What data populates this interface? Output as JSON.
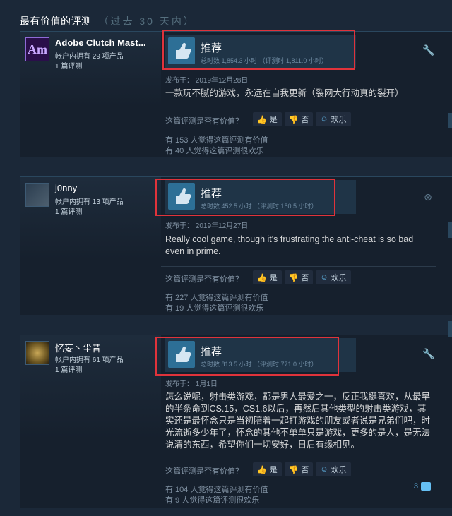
{
  "section": {
    "title": "最有价值的评测",
    "subtitle": "（过去 30 天内）"
  },
  "common": {
    "recommended": "推荐",
    "helpful_question": "这篇评测是否有价值？",
    "yes": "是",
    "no": "否",
    "funny": "欢乐"
  },
  "reviews": [
    {
      "avatar_text": "Am",
      "username": "Adobe Clutch Mast...",
      "owned": "帐户内拥有 29 项产品",
      "review_count": "1 篇评测",
      "hours": "总时数 1,854.3 小时 （评测时 1,811.0 小时）",
      "posted": "发布于：  2019年12月28日",
      "text": "一款玩不腻的游戏，永远在自我更新（裂网大行动真的裂开）",
      "helpful": "有 153 人觉得这篇评测有价值",
      "funny_count": "有 40 人觉得这篇评测很欢乐",
      "corner_icon": "wrench-icon"
    },
    {
      "username": "j0nny",
      "owned": "帐户内拥有 13 项产品",
      "review_count": "1 篇评测",
      "hours": "总时数 452.5 小时 （评测时 150.5 小时）",
      "posted": "发布于：  2019年12月27日",
      "text": "Really cool game, though it's frustrating the anti-cheat is so bad even in prime.",
      "helpful": "有 227 人觉得这篇评测有价值",
      "funny_count": "有 19 人觉得这篇评测很欢乐",
      "corner_icon": "steam-icon"
    },
    {
      "username": "忆妄丶尘昔",
      "owned": "帐户内拥有 61 项产品",
      "review_count": "1 篇评测",
      "hours": "总时数 813.5 小时 （评测时 771.0 小时）",
      "posted": "发布于：  1月1日",
      "text": "怎么说呢，射击类游戏，都是男人最爱之一，反正我挺喜欢，从最早的半条命到CS.15，CS1.6以后，再然后其他类型的射击类游戏，其实还是最怀念只是当初陪着一起打游戏的朋友或者说是兄弟们吧，时光流逝多少年了，怀念的其他不单单只是游戏，更多的是人，是无法说清的东西，希望你们一切安好，日后有缘相见。",
      "helpful": "有 104 人觉得这篇评测有价值",
      "funny_count": "有 9 人觉得这篇评测很欢乐",
      "comments": "3",
      "corner_icon": "wrench-icon"
    }
  ]
}
